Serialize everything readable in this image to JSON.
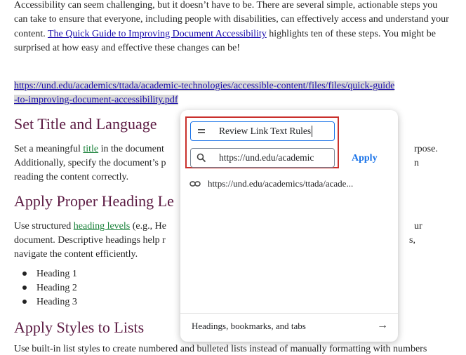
{
  "doc": {
    "intro_pre": "Accessibility can seem challenging, but it doesn’t have to be. There are several simple, actionable steps you can take to ensure that everyone, including people with disabilities, can effectively access and understand your content. ",
    "intro_link": "The Quick Guide to Improving Document Accessibility",
    "intro_post": " highlights ten of these steps. You might be surprised at how easy and effective these changes can be!",
    "url_line1": "https://und.edu/academics/ttada/academic-technologies/accessible-content/files/files/quick-guide",
    "url_line2": "-to-improving-document-accessibility.pdf",
    "h_title": "Set Title and Language",
    "p1_pre": "Set a meaningful ",
    "p1_link": "title",
    "p1_mid": " in the document",
    "p1_right": "rpose.",
    "p1_line2": "Additionally, specify the document’s p",
    "p1_line2_right": "n",
    "p1_line3": "reading the content correctly.",
    "h_heading": "Apply Proper Heading Le",
    "p2_pre": "Use structured ",
    "p2_link": "heading levels",
    "p2_mid": " (e.g., He",
    "p2_right": "ur",
    "p2_line2": "document. Descriptive headings help r",
    "p2_line2_right": "s,",
    "p2_line3": "navigate the content efficiently.",
    "bullets": [
      "Heading 1",
      "Heading 2",
      "Heading 3"
    ],
    "h_lists": "Apply Styles to Lists",
    "cutoff": "Use built-in list styles to create numbered and bulleted lists instead of manually formatting with numbers"
  },
  "popup": {
    "text_value": "Review Link Text Rules",
    "url_value": "https://und.edu/academic",
    "apply_label": "Apply",
    "suggestion": "https://und.edu/academics/ttada/acade...",
    "footer_label": "Headings, bookmarks, and tabs",
    "icons": [
      "text-lines-icon",
      "search-icon",
      "link-icon",
      "arrow-right-icon"
    ]
  }
}
